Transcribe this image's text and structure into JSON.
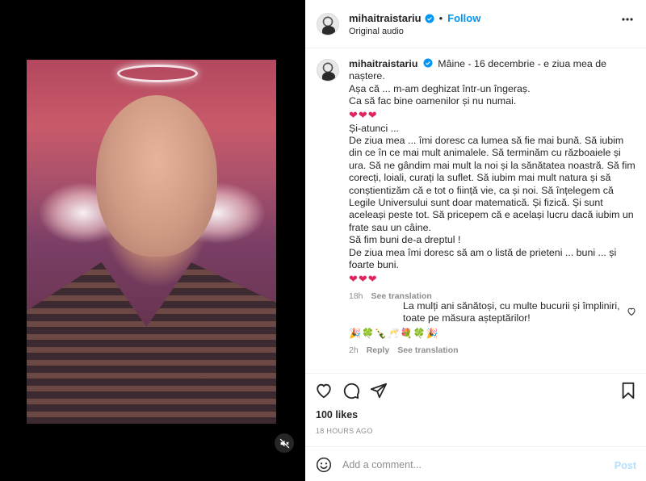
{
  "header": {
    "username": "mihaitraistariu",
    "separator": "•",
    "follow_label": "Follow",
    "audio_label": "Original audio"
  },
  "caption": {
    "username": "mihaitraistariu",
    "lines": [
      "Mâine - 16 decembrie - e ziua mea de naștere.",
      "Așa că ... m-am deghizat într-un îngeraș.",
      "Ca să fac bine oamenilor și nu numai.",
      "❤❤❤",
      "Și-atunci ...",
      "De ziua mea ... îmi doresc ca lumea să fie mai bună. Să iubim din ce în ce mai mult animalele. Să terminăm cu războaiele și ura. Să ne gândim mai mult la noi și la sănătatea noastră. Să fim corecți, loiali, curați la suflet. Să iubim mai mult natura și să conștientizăm că e tot o ființă vie, ca și noi. Să înțelegem că Legile Universului sunt doar matematică. Și fizică. Și sunt aceleași peste tot. Să pricepem că e același lucru dacă iubim un frate sau un câine.",
      "Să fim buni de-a dreptul !",
      "De ziua mea îmi doresc să am o listă de prieteni ... buni ... și foarte buni.",
      "❤❤❤"
    ],
    "time": "18h",
    "see_translation": "See translation"
  },
  "comment": {
    "text": "La mulți ani sănătoși, cu multe bucurii și împliniri, toate pe măsura așteptărilor!",
    "emojis": "🎉🍀🍾🥂💐🍀🎉",
    "time": "2h",
    "reply": "Reply",
    "see_translation": "See translation"
  },
  "likes": "100 likes",
  "timestamp": "18 HOURS AGO",
  "add_comment": {
    "placeholder": "Add a comment...",
    "post_label": "Post"
  },
  "colors": {
    "accent": "#0095f6",
    "heart": "#e0245e",
    "post_disabled": "#b2dffc",
    "muted": "#8e8e8e"
  }
}
